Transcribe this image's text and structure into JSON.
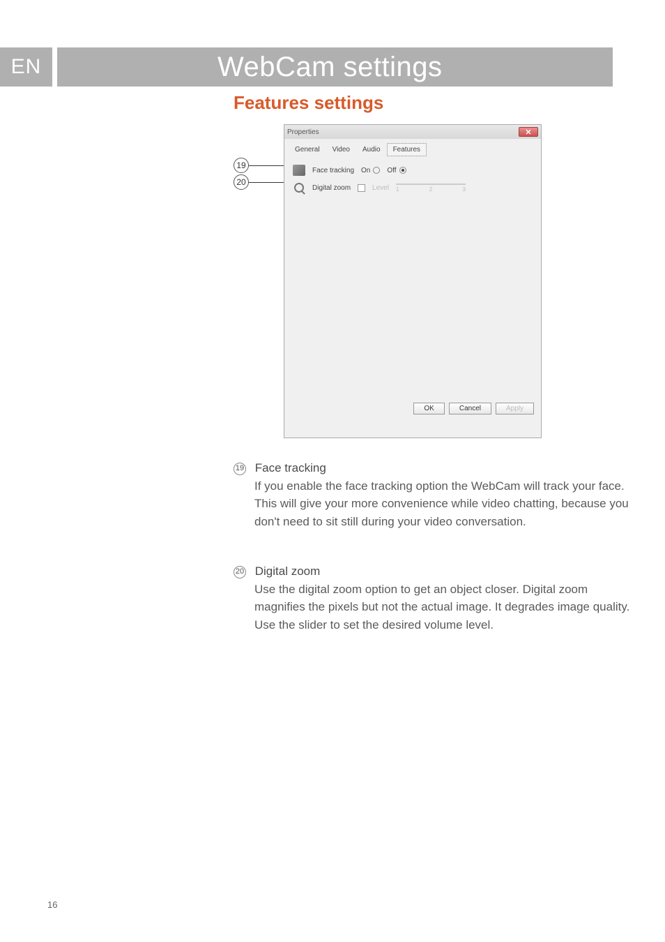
{
  "lang": "EN",
  "page_title": "WebCam settings",
  "section_title": "Features settings",
  "callouts": {
    "c19": "19",
    "c20": "20"
  },
  "dialog": {
    "title": "Properties",
    "tabs": {
      "general": "General",
      "video": "Video",
      "audio": "Audio",
      "features": "Features"
    },
    "rows": {
      "face_tracking": {
        "label": "Face tracking",
        "on": "On",
        "off": "Off"
      },
      "digital_zoom": {
        "label": "Digital zoom",
        "level": "Level",
        "ticks": {
          "t1": "1",
          "t2": "2",
          "t3": "3"
        }
      }
    },
    "buttons": {
      "ok": "OK",
      "cancel": "Cancel",
      "apply": "Apply"
    }
  },
  "items": {
    "i19": {
      "num": "19",
      "title": "Face tracking",
      "text": "If you enable the face tracking option the WebCam will track your face. This will give your more convenience while video chatting, because you don't need to sit still during your video conversation."
    },
    "i20": {
      "num": "20",
      "title": "Digital zoom",
      "text": "Use the digital zoom option to get an object closer. Digital zoom magnifies the pixels but not the actual image. It degrades image quality. Use the slider to set the desired volume level."
    }
  },
  "page_number": "16"
}
